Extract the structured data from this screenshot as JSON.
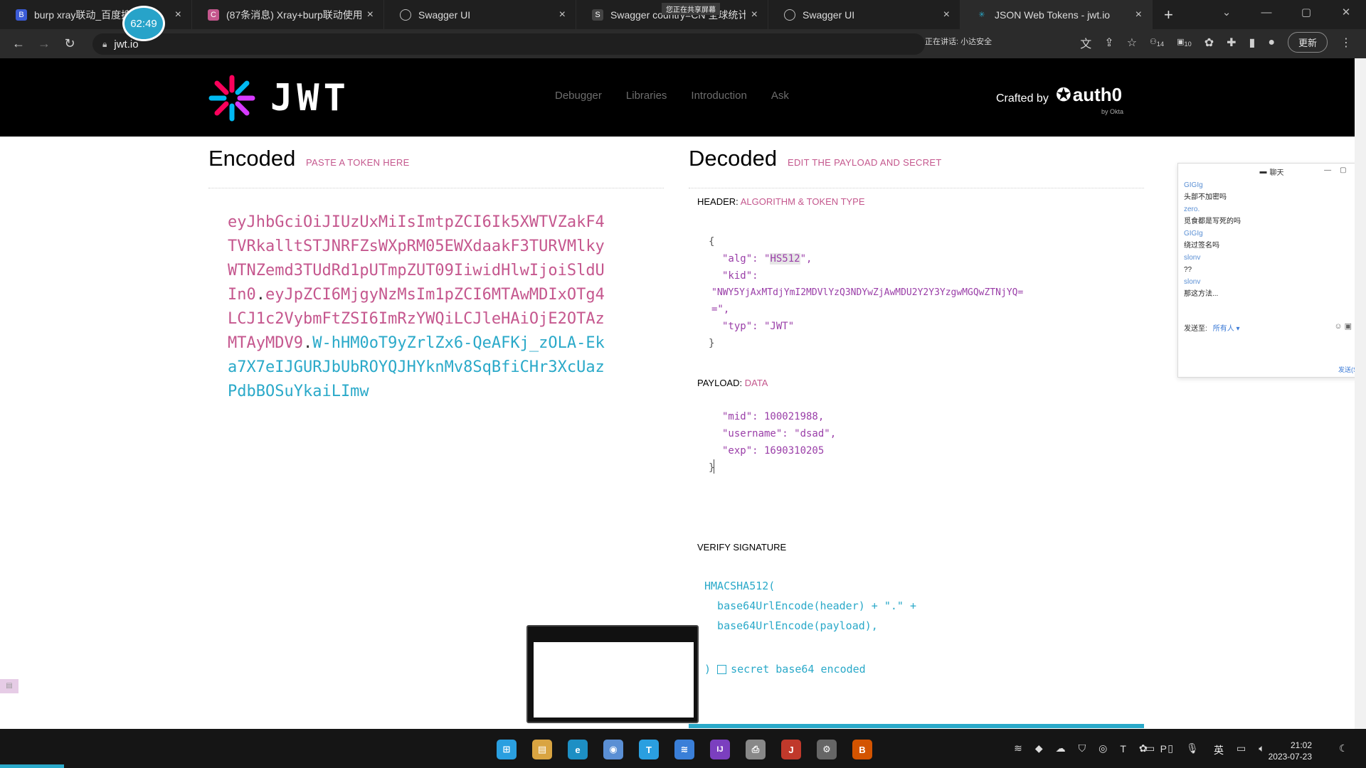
{
  "browser": {
    "tabs": [
      {
        "title": "burp xray联动_百度搜",
        "color": "#3b5bd6",
        "glyph": "B"
      },
      {
        "title": "(87条消息) Xray+burp联动使用",
        "color": "#c4578d",
        "glyph": "C"
      },
      {
        "title": "Swagger UI",
        "color": "#555555",
        "glyph": "S"
      },
      {
        "title": "Swagger country=CN 全球统计",
        "color": "#555555",
        "glyph": "S"
      },
      {
        "title": "Swagger UI",
        "color": "#555555",
        "glyph": "S"
      },
      {
        "title": "JSON Web Tokens - jwt.io",
        "color": "#555555",
        "glyph": "J"
      }
    ],
    "recording_time": "62:49",
    "share_notice": "您正在共享屏幕",
    "url": "jwt.io",
    "sharing_status": "正在讲话: 小达安全",
    "update_label": "更新",
    "badge_14": "14",
    "badge_10": "10"
  },
  "jwt": {
    "logo_text": "JWT",
    "nav": [
      "Debugger",
      "Libraries",
      "Introduction",
      "Ask"
    ],
    "crafted_by": "Crafted by",
    "auth0": "auth0",
    "by_okta": "by Okta",
    "encoded_title": "Encoded",
    "encoded_sub": "PASTE A TOKEN HERE",
    "decoded_title": "Decoded",
    "decoded_sub": "EDIT THE PAYLOAD AND SECRET",
    "token_header": "eyJhbGciOiJIUzUxMiIsImtpZCI6Ik5XWTVZakF4TVRkalltSTJNRFZsWXpRM05EWXdaakF3TURVMlkyWTNZemd3TUdRd1pUTmpZUT09IiwidHlwIjoiSldUIn0",
    "token_payload": "eyJpZCI6MjgyNzMsIm1pZCI6MTAwMDIxOTg4LCJ1c2VybmFtZSI6ImRzYWQiLCJleHAiOjE2OTAzMTAyMDV9",
    "token_signature": "W-hHM0oT9yZrlZx6-QeAFKj_zOLA-Eka7X7eIJGURJbUbROYQJHYknMv8SqBfiCHr3XcUazPdbBOSuYkaiLImw",
    "header_label": "HEADER:",
    "header_hint": "ALGORITHM & TOKEN TYPE",
    "header_lines": {
      "open": "{",
      "alg_key": "\"alg\": \"",
      "alg_val": "HS512",
      "alg_end": "\",",
      "kid_key": "\"kid\":",
      "kid_val": "\"NWY5YjAxMTdjYmI2MDVlYzQ3NDYwZjAwMDU2Y2Y3YzgwMGQwZTNjYQ=",
      "kid_end": "=\",",
      "typ": "\"typ\": \"JWT\"",
      "close": "}"
    },
    "payload_label": "PAYLOAD:",
    "payload_hint": "DATA",
    "payload_lines": {
      "mid": "\"mid\": 100021988,",
      "username": "\"username\": \"dsad\",",
      "exp": "\"exp\": 1690310205",
      "close": "}"
    },
    "verify_label": "VERIFY SIGNATURE",
    "verify_lines": {
      "fn": "HMACSHA512(",
      "arg1": "  base64UrlEncode(header) + \".\" +",
      "arg2": "  base64UrlEncode(payload),",
      "close": ")",
      "secret": "secret base64 encoded"
    }
  },
  "chat": {
    "title": "聊天",
    "messages": [
      {
        "name": "GIGIg",
        "text": "头部不加密吗"
      },
      {
        "name": "zero.",
        "text": "觅食都是写死的吗"
      },
      {
        "name": "GIGIg",
        "text": "绕过签名吗"
      },
      {
        "name": "slonv",
        "text": "??"
      },
      {
        "name": "slonv",
        "text": "那这方法..."
      }
    ],
    "send_to_label": "发送至:",
    "send_to_value": "所有人 ▾",
    "send_button": "发送(S)"
  },
  "taskbar": {
    "apps": [
      {
        "name": "windows",
        "color": "#2a9fe0",
        "glyph": "⊞"
      },
      {
        "name": "file-explorer",
        "color": "#d9a441",
        "glyph": "▤"
      },
      {
        "name": "edge",
        "color": "#1d8fc4",
        "glyph": "e"
      },
      {
        "name": "chrome",
        "color": "#5a8fd4",
        "glyph": "◉"
      },
      {
        "name": "app-t",
        "color": "#2a9fe0",
        "glyph": "T"
      },
      {
        "name": "app-wave",
        "color": "#3a7fd8",
        "glyph": "≋"
      },
      {
        "name": "app-ij",
        "color": "#7b3fbf",
        "glyph": "IJ"
      },
      {
        "name": "app-printer",
        "color": "#888888",
        "glyph": "⎙"
      },
      {
        "name": "java",
        "color": "#c0392b",
        "glyph": "J"
      },
      {
        "name": "settings",
        "color": "#666666",
        "glyph": "⚙"
      },
      {
        "name": "burp",
        "color": "#d35400",
        "glyph": "B"
      }
    ],
    "lang": "英",
    "time": "21:02",
    "date": "2023-07-23"
  },
  "colors": {
    "header_pink": "#c4578d",
    "signature_cyan": "#2aa9c9",
    "header_bg": "#000000"
  }
}
